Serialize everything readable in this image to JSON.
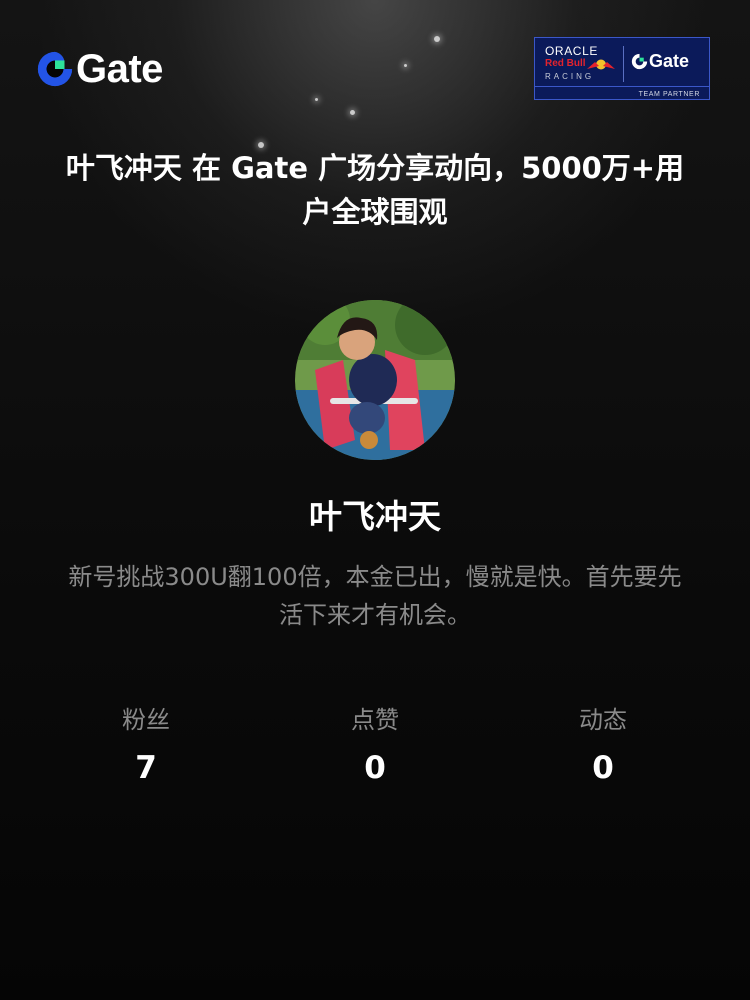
{
  "brand": {
    "name": "Gate",
    "accent": "#2354e6",
    "green": "#2ee39a"
  },
  "partner_badge": {
    "oracle": "ORACLE",
    "redbull": "Red Bull",
    "racing": "RACING",
    "gate": "Gate",
    "caption": "TEAM PARTNER"
  },
  "headline": "叶飞冲天 在 Gate 广场分享动向，5000万+用户全球围观",
  "profile": {
    "name": "叶飞冲天",
    "bio": "新号挑战300U翻100倍，本金已出，慢就是快。首先要先活下来才有机会。"
  },
  "stats": [
    {
      "label": "粉丝",
      "value": "7"
    },
    {
      "label": "点赞",
      "value": "0"
    },
    {
      "label": "动态",
      "value": "0"
    }
  ]
}
